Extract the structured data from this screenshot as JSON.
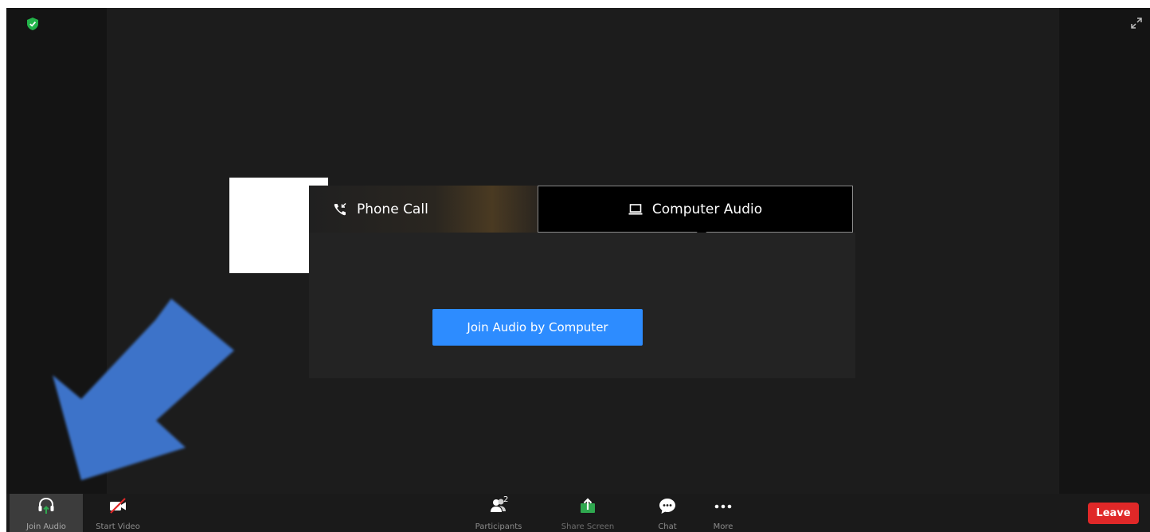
{
  "window": {
    "security_icon": "shield-check-icon",
    "fullscreen_icon": "expand-icon"
  },
  "dialog": {
    "tabs": [
      {
        "label": "Phone Call",
        "icon": "phone-call-icon"
      },
      {
        "label": "Computer Audio",
        "icon": "laptop-icon"
      }
    ],
    "join_button": "Join Audio by Computer"
  },
  "toolbar": {
    "join_audio": "Join Audio",
    "start_video": "Start Video",
    "participants": "Participants",
    "participants_count": "2",
    "share_screen": "Share Screen",
    "chat": "Chat",
    "more": "More",
    "leave": "Leave"
  },
  "colors": {
    "accent_blue": "#2d8cff",
    "leave_red": "#e02828",
    "share_green": "#2fa84f",
    "annotation_arrow": "#3e73c9"
  }
}
